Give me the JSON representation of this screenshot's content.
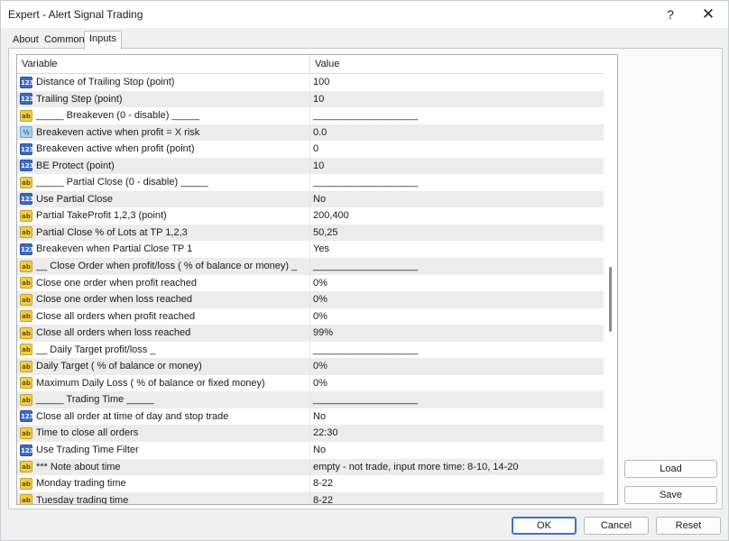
{
  "window": {
    "title": "Expert - Alert Signal Trading",
    "help_label": "?",
    "close_label": "✕"
  },
  "tabs": [
    {
      "label": "About"
    },
    {
      "label": "Common"
    },
    {
      "label": "Inputs"
    }
  ],
  "grid": {
    "header": {
      "variable": "Variable",
      "value": "Value"
    },
    "rows": [
      {
        "icon": "int",
        "icon_text": "123",
        "name": "Distance of Trailing Stop (point)",
        "value": "100"
      },
      {
        "icon": "int",
        "icon_text": "123",
        "name": "Trailing Step (point)",
        "value": "10"
      },
      {
        "icon": "str",
        "icon_text": "ab",
        "name": "_____ Breakeven (0 - disable) _____",
        "value": "___________________"
      },
      {
        "icon": "dbl",
        "icon_text": "½",
        "name": "Breakeven active when profit = X risk",
        "value": "0.0"
      },
      {
        "icon": "int",
        "icon_text": "123",
        "name": "Breakeven active when profit (point)",
        "value": "0"
      },
      {
        "icon": "int",
        "icon_text": "123",
        "name": "BE Protect (point)",
        "value": "10"
      },
      {
        "icon": "str",
        "icon_text": "ab",
        "name": "_____ Partial Close (0 - disable) _____",
        "value": "___________________"
      },
      {
        "icon": "int",
        "icon_text": "123",
        "name": "Use Partial Close",
        "value": "No"
      },
      {
        "icon": "str",
        "icon_text": "ab",
        "name": "Partial TakeProfit 1,2,3 (point)",
        "value": "200,400"
      },
      {
        "icon": "str",
        "icon_text": "ab",
        "name": "Partial Close % of Lots at TP 1,2,3",
        "value": "50,25"
      },
      {
        "icon": "int",
        "icon_text": "123",
        "name": "Breakeven when Partial Close TP 1",
        "value": "Yes"
      },
      {
        "icon": "str",
        "icon_text": "ab",
        "name": "__ Close Order when profit/loss ( % of balance or money) _",
        "value": "___________________"
      },
      {
        "icon": "str",
        "icon_text": "ab",
        "name": "Close one order when profit reached",
        "value": "0%"
      },
      {
        "icon": "str",
        "icon_text": "ab",
        "name": "Close one order when loss reached",
        "value": "0%"
      },
      {
        "icon": "str",
        "icon_text": "ab",
        "name": "Close all orders when profit reached",
        "value": "0%"
      },
      {
        "icon": "str",
        "icon_text": "ab",
        "name": "Close all orders when loss reached",
        "value": "99%"
      },
      {
        "icon": "str",
        "icon_text": "ab",
        "name": "__ Daily Target profit/loss _",
        "value": "___________________"
      },
      {
        "icon": "str",
        "icon_text": "ab",
        "name": "Daily Target ( % of balance or money)",
        "value": "0%"
      },
      {
        "icon": "str",
        "icon_text": "ab",
        "name": "Maximum Daily Loss ( % of balance or fixed money)",
        "value": "0%"
      },
      {
        "icon": "str",
        "icon_text": "ab",
        "name": "_____ Trading Time _____",
        "value": "___________________"
      },
      {
        "icon": "int",
        "icon_text": "123",
        "name": "Close all order at time of day and stop trade",
        "value": "No"
      },
      {
        "icon": "str",
        "icon_text": "ab",
        "name": "Time to close all orders",
        "value": "22:30"
      },
      {
        "icon": "int",
        "icon_text": "123",
        "name": "Use Trading Time Filter",
        "value": "No"
      },
      {
        "icon": "str",
        "icon_text": "ab",
        "name": "*** Note about time",
        "value": "empty - not trade, input more time: 8-10, 14-20"
      },
      {
        "icon": "str",
        "icon_text": "ab",
        "name": "Monday trading time",
        "value": "8-22"
      },
      {
        "icon": "str",
        "icon_text": "ab",
        "name": "Tuesday trading time",
        "value": "8-22"
      }
    ]
  },
  "buttons": {
    "load": "Load",
    "save": "Save",
    "ok": "OK",
    "cancel": "Cancel",
    "reset": "Reset"
  }
}
